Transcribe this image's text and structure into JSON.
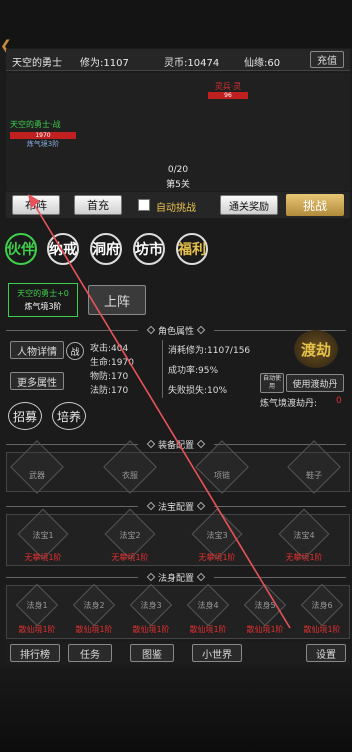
{
  "header": {
    "name": "天空的勇士",
    "cultivation": "修为:1107",
    "spirit_coin": "灵币:10474",
    "destiny": "仙缘:60",
    "recharge": "充值"
  },
  "battle": {
    "enemy_name": "灵兵·灵",
    "enemy_hp": "96",
    "player_name": "天空的勇士·战",
    "player_hp": "1970",
    "player_realm": "炼气境3阶",
    "progress": "0/20",
    "level": "第5关"
  },
  "actions": {
    "formation": "布阵",
    "first_charge": "首充",
    "auto_challenge": "自动挑战",
    "clear_reward": "通关奖励",
    "challenge": "挑战"
  },
  "nav": [
    "伙伴",
    "纳戒",
    "洞府",
    "坊市",
    "福利"
  ],
  "partner": {
    "name": "天空的勇士+0",
    "realm": "炼气境3阶",
    "deploy": "上阵"
  },
  "attributes": {
    "title": "角色属性",
    "detail": "人物详情",
    "battle_icon": "战",
    "more": "更多属性",
    "recruit": "招募",
    "train": "培养",
    "attack": "攻击:404",
    "hp": "生命:1970",
    "pdef": "物防:170",
    "mdef": "法防:170",
    "cost": "消耗修为:1107/156",
    "success": "成功率:95%",
    "loss": "失败损失:10%",
    "tribulation_logo": "渡劫",
    "auto_use": "自动使用",
    "use_pill": "使用渡劫丹",
    "pill_label": "炼气境渡劫丹:",
    "pill_count": "0"
  },
  "equipment": {
    "title": "装备配置",
    "slots": [
      "武器",
      "衣服",
      "项链",
      "鞋子"
    ]
  },
  "treasure": {
    "title": "法宝配置",
    "slots": [
      "法宝1",
      "法宝2",
      "法宝3",
      "法宝4"
    ],
    "status": "无攀境1阶"
  },
  "body": {
    "title": "法身配置",
    "slots": [
      "法身1",
      "法身2",
      "法身3",
      "法身4",
      "法身5",
      "法身6"
    ],
    "status": "散仙境1阶"
  },
  "bottom": {
    "ranking": "排行榜",
    "tasks": "任务",
    "codex": "图鉴",
    "small_world": "小世界",
    "settings": "设置"
  },
  "colors": {
    "accent_green": "#3fd04b",
    "gold": "#e6c14a",
    "red": "#e03030"
  }
}
